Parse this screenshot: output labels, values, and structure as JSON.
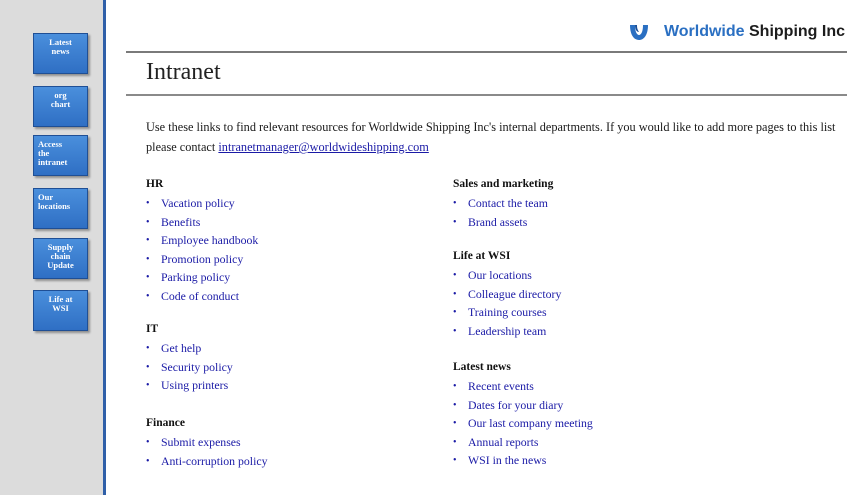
{
  "sidebar": {
    "items": [
      {
        "label": "Latest\nnews"
      },
      {
        "label": "org\nchart"
      },
      {
        "label": "Access\nthe\nintranet"
      },
      {
        "label": "Our\nlocations"
      },
      {
        "label": "Supply\nchain\nUpdate"
      },
      {
        "label": "Life at\nWSI"
      }
    ]
  },
  "header": {
    "logo_word1": "Worldwide",
    "logo_word2": "Shipping Inc",
    "brand_color": "#2a6fc2",
    "logo_icon": "shipping-logo-icon"
  },
  "main": {
    "title": "Intranet",
    "intro_text": "Use these links to find relevant resources for Worldwide Shipping Inc's internal departments. If you would like to add more pages to this list please contact ",
    "contact_email": "intranetmanager@worldwideshipping.com"
  },
  "sections": {
    "hr": {
      "heading": "HR",
      "links": [
        "Vacation policy",
        "Benefits",
        "Employee handbook",
        "Promotion policy",
        "Parking policy",
        "Code of conduct"
      ]
    },
    "it": {
      "heading": "IT",
      "links": [
        "Get help",
        "Security policy",
        "Using printers"
      ]
    },
    "finance": {
      "heading": "Finance",
      "links": [
        "Submit expenses",
        "Anti-corruption policy"
      ]
    },
    "sales": {
      "heading": "Sales and marketing",
      "links": [
        "Contact the team",
        "Brand assets"
      ]
    },
    "life": {
      "heading": "Life at WSI",
      "links": [
        "Our locations",
        "Colleague directory",
        "Training courses",
        "Leadership team"
      ]
    },
    "news": {
      "heading": "Latest news",
      "links": [
        "Recent events",
        "Dates for your diary",
        "Our last company meeting",
        "Annual reports",
        "WSI in the news"
      ]
    }
  }
}
